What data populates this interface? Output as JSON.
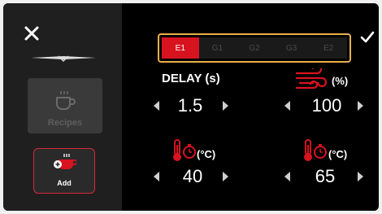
{
  "sidebar": {
    "recipes_label": "Recipes",
    "add_label": "Add"
  },
  "tabs": [
    {
      "label": "E1",
      "active": true
    },
    {
      "label": "G1",
      "active": false
    },
    {
      "label": "G2",
      "active": false
    },
    {
      "label": "G3",
      "active": false
    },
    {
      "label": "E2",
      "active": false
    }
  ],
  "params": {
    "delay": {
      "title": "DELAY (s)",
      "value": "1.5"
    },
    "airflow": {
      "unit": "(%)",
      "value": "100",
      "icon": "airflow-icon"
    },
    "temp1": {
      "unit": "(°C)",
      "value": "40",
      "icon": "thermometer-timer-icon"
    },
    "temp2": {
      "unit": "(°C)",
      "value": "65",
      "icon": "thermometer-timer-icon"
    }
  },
  "colors": {
    "accent": "#d7131f",
    "highlight": "#e8b04a"
  }
}
